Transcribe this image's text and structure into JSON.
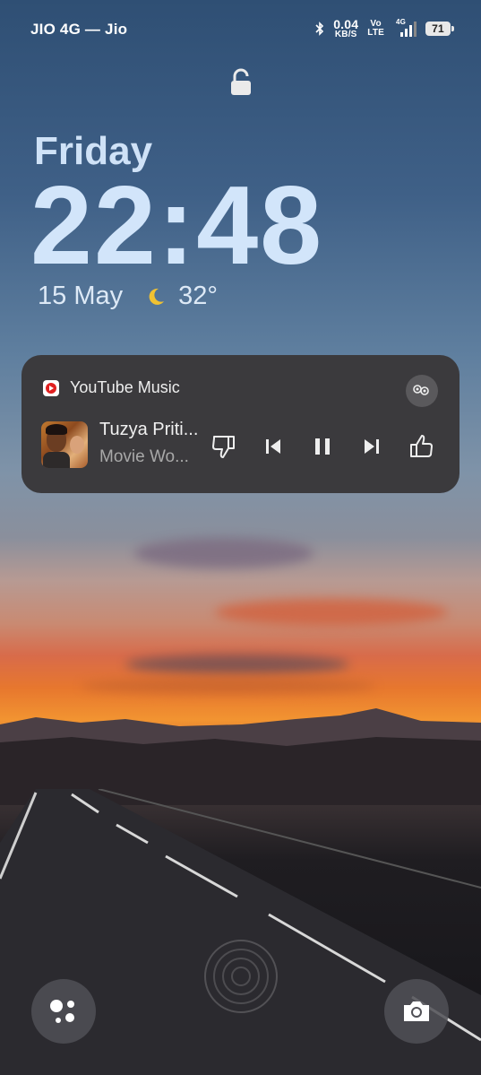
{
  "status_bar": {
    "carrier": "JIO 4G — Jio",
    "speed_value": "0.04",
    "speed_unit": "KB/S",
    "volte_top": "Vo",
    "volte_bottom": "LTE",
    "network": "4G",
    "battery": "71",
    "icons": [
      "bluetooth-icon",
      "signal-icon",
      "battery-icon"
    ]
  },
  "lock_icon": "lock-icon",
  "clock": {
    "day": "Friday",
    "time": "22:48",
    "date": "15 May",
    "weather_icon": "moon-icon",
    "temperature": "32°"
  },
  "media_player": {
    "app_name": "YouTube Music",
    "song_title": "Tuzya Priti...",
    "subtitle": "Movie Wo...",
    "controls": [
      "dislike-icon",
      "previous-icon",
      "pause-icon",
      "next-icon",
      "like-icon"
    ],
    "output_icon": "cast-device-icon"
  },
  "shortcuts": {
    "left": "assistant-icon",
    "right": "camera-icon"
  },
  "colors": {
    "time_text": "#d2e5fa",
    "card_bg": "#3b3a3d"
  }
}
